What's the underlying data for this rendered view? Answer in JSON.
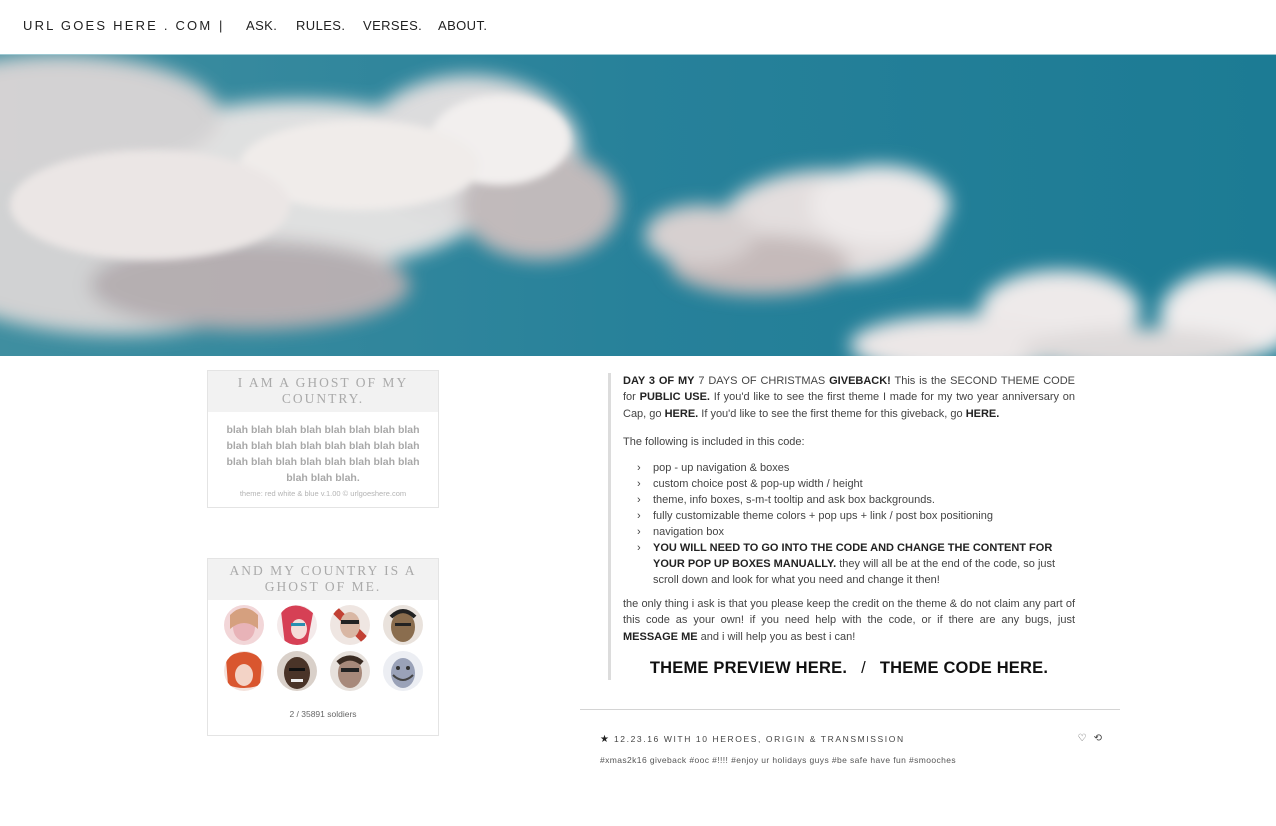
{
  "nav": {
    "url": "URL GOES HERE . COM",
    "separator": "|",
    "links": [
      "ASK.",
      "RULES.",
      "VERSES.",
      "ABOUT."
    ]
  },
  "sidebar": {
    "box1": {
      "title": "I AM A GHOST OF MY COUNTRY.",
      "body": "blah blah blah blah blah blah blah blah blah blah blah blah blah blah blah blah blah blah blah blah blah blah blah blah blah blah blah.",
      "credit": "theme: red white & blue v.1.00 © urlgoeshere.com"
    },
    "box2": {
      "title": "AND MY COUNTRY IS A GHOST OF ME.",
      "count": "2 / 35891 soldiers",
      "avatar_colors": [
        "#e8b3b8",
        "#d64055",
        "#c24134",
        "#8a6d4e",
        "#d9562f",
        "#4a3428",
        "#a7897a",
        "#9aa2b8"
      ]
    }
  },
  "post": {
    "p1": {
      "a": "DAY 3 OF MY",
      "b": " 7 DAYS OF CHRISTMAS ",
      "c": "GIVEBACK!",
      "d": " This is the SECOND THEME CODE for ",
      "e": "PUBLIC USE.",
      "f": " If you'd like to see the first theme I made for my two year anniversary on Cap, go ",
      "g": "HERE.",
      "h": " If you'd like to see the first theme for this giveback, go ",
      "i": "HERE."
    },
    "p2": "The following is included in this code:",
    "bullet_glyph": "›",
    "bullets": [
      "pop - up navigation & boxes",
      "custom choice post & pop-up width / height",
      "theme, info boxes, s-m-t tooltip and ask box backgrounds.",
      "fully customizable theme colors + pop ups + link / post box positioning",
      "navigation box"
    ],
    "last_bullet": {
      "bold": "YOU WILL NEED TO GO INTO THE CODE AND CHANGE THE CONTENT FOR YOUR POP UP BOXES MANUALLY.",
      "rest": " they will all be at the end of the code, so just scroll down and look for what you need and change it then!"
    },
    "p3": {
      "a": "the only thing i ask is that you please keep the credit on the theme & do not claim any part of this code as your own! if you need help with the code, or if there are any bugs, just ",
      "b": "MESSAGE ME",
      "c": " and i will help you as best i can!"
    },
    "links": {
      "preview": "THEME PREVIEW HERE.",
      "slash": "/",
      "code": "THEME CODE HERE."
    }
  },
  "footer": {
    "star": "★",
    "meta": "12.23.16 WITH 10 HEROES, ORIGIN & TRANSMISSION",
    "like_icon": "♡",
    "reblog_icon": "⟲",
    "tags": "#xmas2k16 giveback #ooc #!!!! #enjoy ur holidays guys #be safe have fun #smooches"
  }
}
